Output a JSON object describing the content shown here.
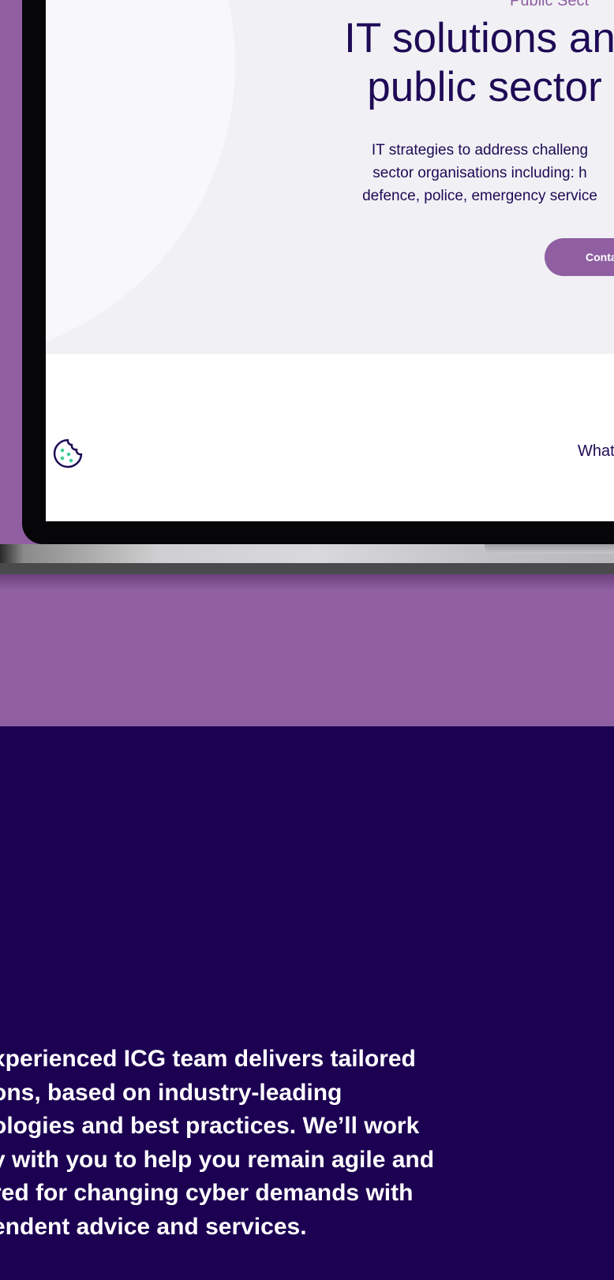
{
  "hero": {
    "eyebrow": "Public Sect",
    "title_line1": "IT solutions an",
    "title_line2": "public sector",
    "subtitle_lines": [
      "IT strategies to address challeng",
      "sector organisations including: h",
      "defence, police, emergency service"
    ],
    "cta_label": "Conta"
  },
  "nav": {
    "what_label": "What"
  },
  "icons": {
    "cookie": "cookie-icon"
  },
  "colors": {
    "brand_purple": "#8f5fa2",
    "navy": "#1c0052",
    "heading": "#1e0a55",
    "cookie_dots": "#3fcf9a"
  },
  "about": {
    "lines": [
      "xperienced ICG team delivers tailored",
      "ons, based on industry-leading",
      "ologies and best practices. We’ll work",
      "y with you to help you remain agile and",
      "red for changing cyber demands with",
      "endent advice and services."
    ]
  }
}
